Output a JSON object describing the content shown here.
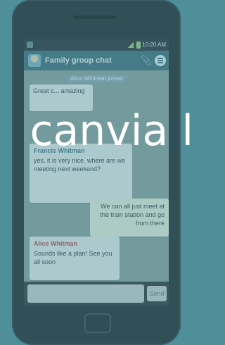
{
  "statusbar": {
    "time": "10:20 AM"
  },
  "chat": {
    "title": "Family group chat",
    "system_note": "Alice Whitman joined",
    "messages": [
      {
        "sender": "",
        "text": "Great c... amazing",
        "meta": ""
      },
      {
        "sender": "Francis Whitman",
        "text": "yes, it is very nice. where are we meeting next weekend?",
        "meta": ""
      },
      {
        "sender": "",
        "text": "We can all just meet at the train station and go from there",
        "meta": ""
      },
      {
        "sender": "Alice Whitman",
        "text": "Sounds like a plan! See you all soon",
        "meta": ""
      }
    ]
  },
  "composer": {
    "send_label": "Send",
    "placeholder": ""
  },
  "watermark": {
    "text": "canvia l"
  },
  "colors": {
    "background": "#4f8f9a",
    "header": "#3f6f7b",
    "bubble": "#e9f0f1"
  },
  "icons": {
    "attach": "paperclip-icon",
    "menu": "menu-icon",
    "avatar": "group-avatar-icon"
  }
}
